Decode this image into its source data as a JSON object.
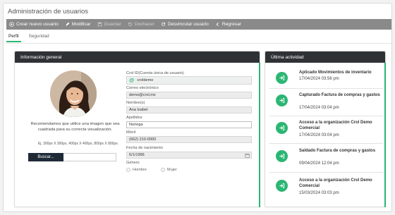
{
  "window": {
    "title": "Administración de usuarios"
  },
  "toolbar": {
    "create_label": "Crear nuevo usuario",
    "modify_label": "Modificar",
    "save_label": "Guardar",
    "undo_label": "Deshacer",
    "unlink_label": "Desvincular usuario",
    "back_label": "Regresar"
  },
  "tabs": {
    "profile": "Perfil",
    "security": "Seguridad"
  },
  "general": {
    "header": "Información general",
    "recommendation": "Recomendamos que utilice una imagen que sea cuadrada para su correcta visualización.",
    "dimensions": "Ej. 300px X 300px, 400px X 400px, 800px X 800px.",
    "browse_label": "Buscar..."
  },
  "form": {
    "user_label": "Crol ID(Cuenta única de usuario)",
    "user_value": "croldemo",
    "email_label": "Correo electrónico",
    "email_value": "demo@crol.mx",
    "name_label": "Nombre(s)",
    "name_value": "Ana Isabel",
    "lastname_label": "Apellidos",
    "lastname_value": "Noriega",
    "mobile_label": "Móvil",
    "mobile_value": "(662) 210-0000",
    "birth_label": "Fecha de nacimiento",
    "birth_value": "6/1/1996",
    "gender_label": "Género",
    "gender_male": "Hombre",
    "gender_female": "Mujer"
  },
  "activity": {
    "header": "Última actividad",
    "items": [
      {
        "title": "Aplicado Movimientos de inventario",
        "date": "17/04/2024 03:56 pm"
      },
      {
        "title": "Capturado Factura de compras y gastos",
        "date": "17/04/2024 03:04 pm"
      },
      {
        "title": "Acceso a la organización Crol Demo Comercial",
        "date": "17/04/2024 03:04 pm"
      },
      {
        "title": "Saldado Factura de compras y gastos",
        "date": "09/04/2024 12:04 pm"
      },
      {
        "title": "Acceso a la organización Crol Demo Comercial",
        "date": "15/03/2024 03:03 pm"
      }
    ]
  },
  "colors": {
    "accent": "#2bb673",
    "toolbar": "#8a8a8a",
    "panel_header": "#2f3235"
  }
}
